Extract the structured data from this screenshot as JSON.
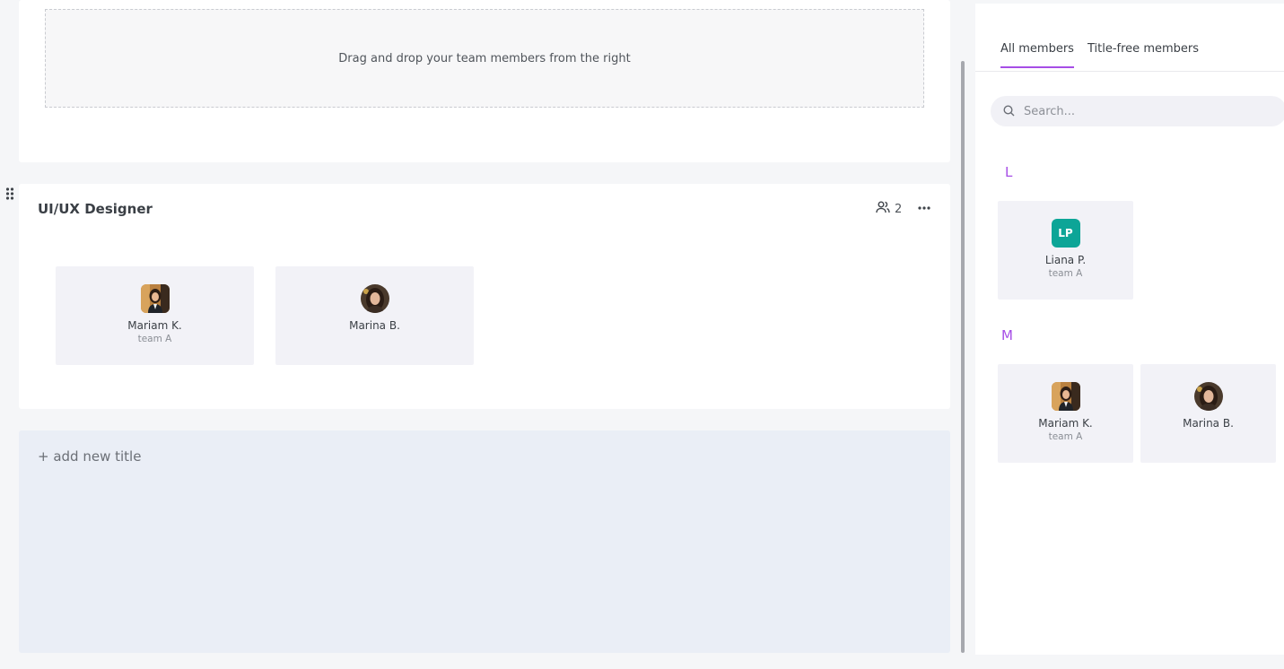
{
  "dropzone": {
    "text": "Drag and drop your team members from the right"
  },
  "title_card": {
    "name": "UI/UX Designer",
    "count": "2",
    "members": [
      {
        "name": "Mariam K.",
        "team": "team A",
        "avatar": "photo-avatar"
      },
      {
        "name": "Marina B.",
        "team": "",
        "avatar": "photo-avatar"
      }
    ]
  },
  "add_title": {
    "label": "+ add new title"
  },
  "panel": {
    "tabs": [
      {
        "label": "All members",
        "active": true
      },
      {
        "label": "Title-free members",
        "active": false
      }
    ],
    "search": {
      "placeholder": "Search..."
    },
    "groups": [
      {
        "letter": "L",
        "members": [
          {
            "name": "Liana P.",
            "team": "team A",
            "initials": "LP",
            "color": "#0da597"
          }
        ]
      },
      {
        "letter": "M",
        "members": [
          {
            "name": "Mariam K.",
            "team": "team A"
          },
          {
            "name": "Marina B.",
            "team": ""
          }
        ]
      }
    ]
  },
  "colors": {
    "accent": "#a64ee6",
    "card_bg": "#f2f2f7",
    "add_bg": "#eaeef6"
  }
}
